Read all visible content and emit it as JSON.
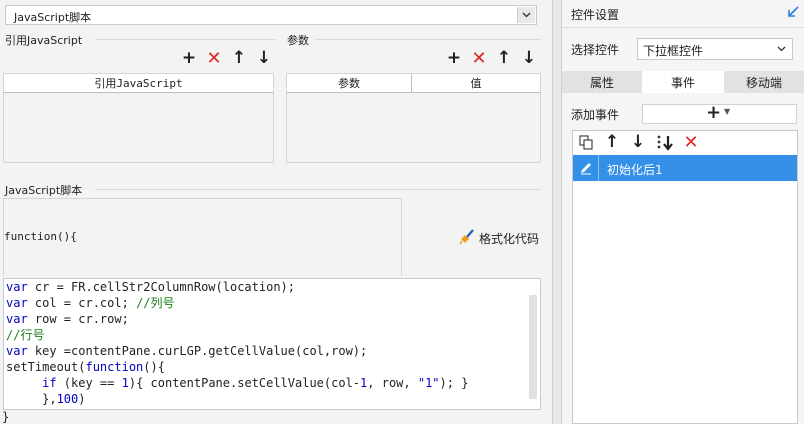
{
  "left": {
    "type_select_value": "JavaScript脚本",
    "ref_js_section_label": "引用JavaScript",
    "params_section_label": "参数",
    "ref_js_table_header": "引用JavaScript",
    "params_table_headers": [
      "参数",
      "值"
    ],
    "script_section_label": "JavaScript脚本",
    "function_header": "function(){",
    "format_code_label": "格式化代码",
    "code_lines": [
      "var cr = FR.cellStr2ColumnRow(location);",
      "var col = cr.col; //列号",
      "var row = cr.row;",
      "//行号",
      "var key =contentPane.curLGP.getCellValue(col,row);",
      "setTimeout(function(){",
      "     if (key == 1){ contentPane.setCellValue(col-1, row, \"1\"); }",
      "     },100)"
    ],
    "closing_brace": "}"
  },
  "right": {
    "title": "控件设置",
    "select_label": "选择控件",
    "select_value": "下拉框控件",
    "tabs": [
      "属性",
      "事件",
      "移动端"
    ],
    "active_tab": "事件",
    "add_event_label": "添加事件",
    "add_event_plus": "+",
    "event_items": [
      "初始化后1"
    ]
  },
  "colors": {
    "accent": "#3390e6",
    "delete_red": "#e0262a",
    "keyword_blue": "#0000c8",
    "comment_green": "#1a7f1a"
  },
  "icons": [
    "chevron-down-icon",
    "plus-icon",
    "delete-icon",
    "arrow-up-icon",
    "arrow-down-icon",
    "broom-icon",
    "copy-icon",
    "move-bottom-icon",
    "pencil-icon",
    "collapse-icon"
  ]
}
